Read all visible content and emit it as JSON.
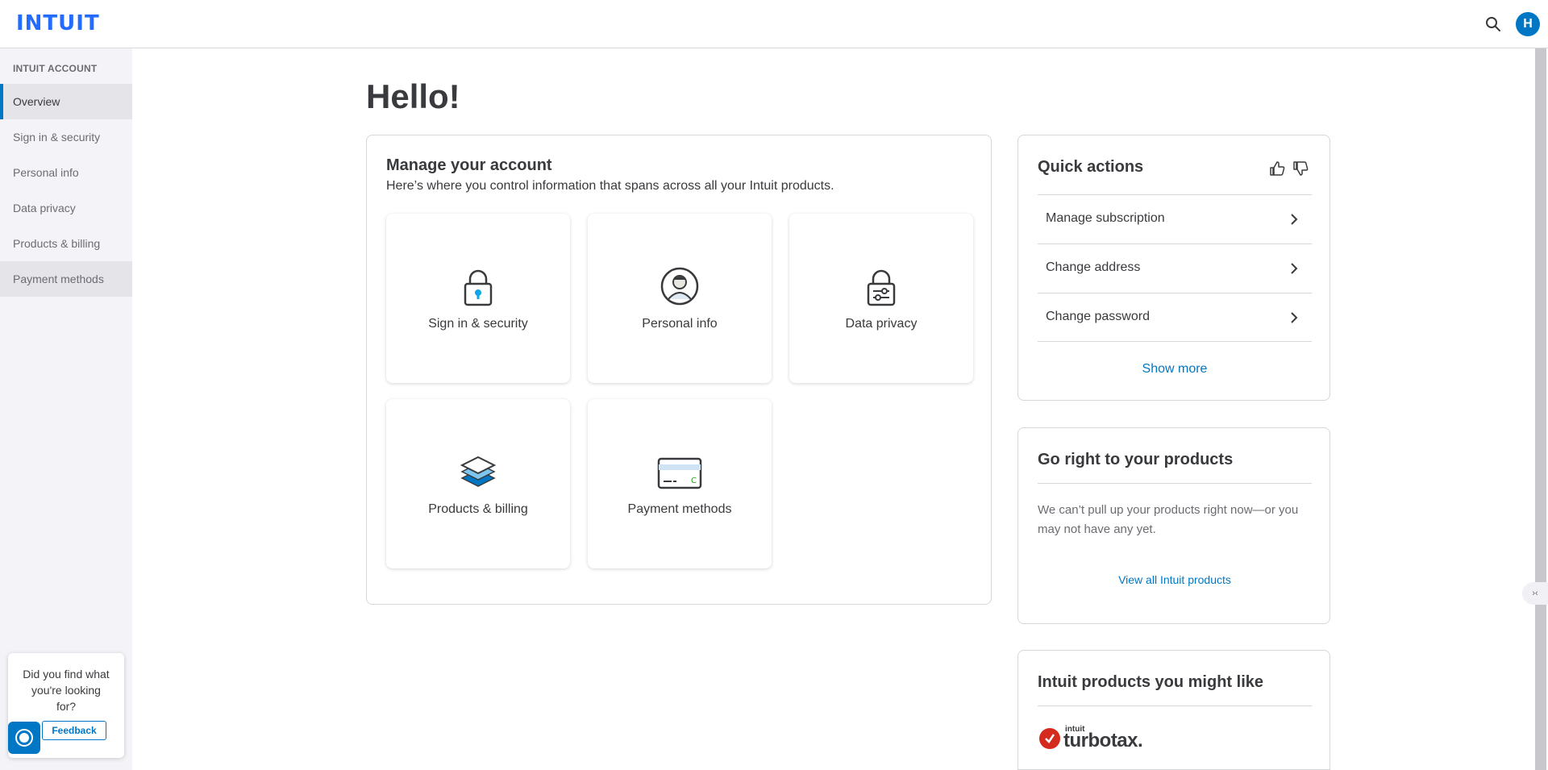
{
  "header": {
    "logo": "INTUIT",
    "avatar_initial": "H",
    "brand_color": "#236cff",
    "accent_color": "#0077c5"
  },
  "sidebar": {
    "heading": "INTUIT ACCOUNT",
    "items": [
      {
        "label": "Overview",
        "active": true
      },
      {
        "label": "Sign in & security"
      },
      {
        "label": "Personal info"
      },
      {
        "label": "Data privacy"
      },
      {
        "label": "Products & billing"
      },
      {
        "label": "Payment methods",
        "hover": true
      }
    ],
    "feedback": {
      "prompt": "Did you find what you're looking for?",
      "button": "Feedback"
    }
  },
  "main": {
    "title": "Hello!",
    "manage": {
      "title": "Manage your account",
      "subtitle": "Here’s where you control information that spans across all your Intuit products.",
      "tiles": [
        {
          "label": "Sign in & security",
          "icon": "lock-icon"
        },
        {
          "label": "Personal info",
          "icon": "person-icon"
        },
        {
          "label": "Data privacy",
          "icon": "privacy-lock-icon"
        },
        {
          "label": "Products & billing",
          "icon": "layers-icon"
        },
        {
          "label": "Payment methods",
          "icon": "credit-card-icon"
        }
      ]
    },
    "quick_actions": {
      "title": "Quick actions",
      "items": [
        "Manage subscription",
        "Change address",
        "Change password"
      ],
      "show_more": "Show more"
    },
    "go_products": {
      "title": "Go right to your products",
      "text": "We can’t pull up your products right now—or you may not have any yet.",
      "link": "View all Intuit products"
    },
    "might_like": {
      "title": "Intuit products you might like",
      "logo_small": "intuit",
      "logo_big": "turbotax."
    }
  }
}
